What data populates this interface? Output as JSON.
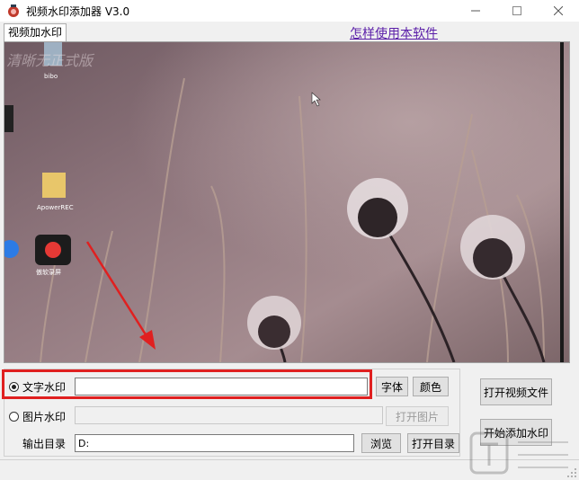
{
  "window": {
    "title": "视频水印添加器 V3.0",
    "minimize_icon": "minimize-icon",
    "maximize_icon": "maximize-icon",
    "close_icon": "close-icon"
  },
  "tabs": [
    {
      "label": "视频加水印",
      "active": true
    }
  ],
  "help_link": "怎样使用本软件",
  "preview": {
    "overlay_text": "清晰无正式版",
    "desktop_icons": [
      "bibo",
      "ApowerREC",
      "傲软录屏"
    ]
  },
  "watermark_options": {
    "text_label": "文字水印",
    "text_value": "",
    "text_selected": true,
    "font_button": "字体",
    "color_button": "颜色",
    "image_label": "图片水印",
    "image_value": "",
    "image_selected": false,
    "open_image_button": "打开图片"
  },
  "output": {
    "label": "输出目录",
    "value": "D:",
    "browse_button": "浏览",
    "open_dir_button": "打开目录"
  },
  "actions": {
    "open_video": "打开视频文件",
    "start": "开始添加水印"
  },
  "colors": {
    "highlight": "#e02020",
    "link": "#5a1ea8"
  }
}
